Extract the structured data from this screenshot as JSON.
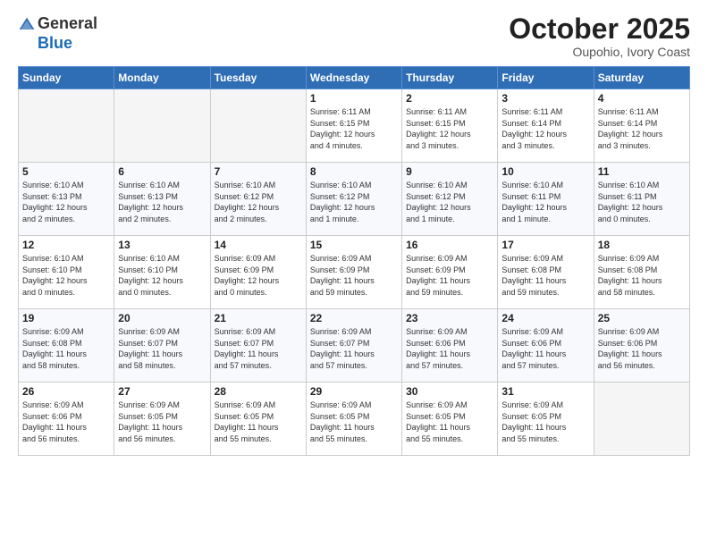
{
  "header": {
    "logo_general": "General",
    "logo_blue": "Blue",
    "month": "October 2025",
    "location": "Oupohio, Ivory Coast"
  },
  "days_of_week": [
    "Sunday",
    "Monday",
    "Tuesday",
    "Wednesday",
    "Thursday",
    "Friday",
    "Saturday"
  ],
  "weeks": [
    [
      {
        "day": "",
        "info": ""
      },
      {
        "day": "",
        "info": ""
      },
      {
        "day": "",
        "info": ""
      },
      {
        "day": "1",
        "info": "Sunrise: 6:11 AM\nSunset: 6:15 PM\nDaylight: 12 hours\nand 4 minutes."
      },
      {
        "day": "2",
        "info": "Sunrise: 6:11 AM\nSunset: 6:15 PM\nDaylight: 12 hours\nand 3 minutes."
      },
      {
        "day": "3",
        "info": "Sunrise: 6:11 AM\nSunset: 6:14 PM\nDaylight: 12 hours\nand 3 minutes."
      },
      {
        "day": "4",
        "info": "Sunrise: 6:11 AM\nSunset: 6:14 PM\nDaylight: 12 hours\nand 3 minutes."
      }
    ],
    [
      {
        "day": "5",
        "info": "Sunrise: 6:10 AM\nSunset: 6:13 PM\nDaylight: 12 hours\nand 2 minutes."
      },
      {
        "day": "6",
        "info": "Sunrise: 6:10 AM\nSunset: 6:13 PM\nDaylight: 12 hours\nand 2 minutes."
      },
      {
        "day": "7",
        "info": "Sunrise: 6:10 AM\nSunset: 6:12 PM\nDaylight: 12 hours\nand 2 minutes."
      },
      {
        "day": "8",
        "info": "Sunrise: 6:10 AM\nSunset: 6:12 PM\nDaylight: 12 hours\nand 1 minute."
      },
      {
        "day": "9",
        "info": "Sunrise: 6:10 AM\nSunset: 6:12 PM\nDaylight: 12 hours\nand 1 minute."
      },
      {
        "day": "10",
        "info": "Sunrise: 6:10 AM\nSunset: 6:11 PM\nDaylight: 12 hours\nand 1 minute."
      },
      {
        "day": "11",
        "info": "Sunrise: 6:10 AM\nSunset: 6:11 PM\nDaylight: 12 hours\nand 0 minutes."
      }
    ],
    [
      {
        "day": "12",
        "info": "Sunrise: 6:10 AM\nSunset: 6:10 PM\nDaylight: 12 hours\nand 0 minutes."
      },
      {
        "day": "13",
        "info": "Sunrise: 6:10 AM\nSunset: 6:10 PM\nDaylight: 12 hours\nand 0 minutes."
      },
      {
        "day": "14",
        "info": "Sunrise: 6:09 AM\nSunset: 6:09 PM\nDaylight: 12 hours\nand 0 minutes."
      },
      {
        "day": "15",
        "info": "Sunrise: 6:09 AM\nSunset: 6:09 PM\nDaylight: 11 hours\nand 59 minutes."
      },
      {
        "day": "16",
        "info": "Sunrise: 6:09 AM\nSunset: 6:09 PM\nDaylight: 11 hours\nand 59 minutes."
      },
      {
        "day": "17",
        "info": "Sunrise: 6:09 AM\nSunset: 6:08 PM\nDaylight: 11 hours\nand 59 minutes."
      },
      {
        "day": "18",
        "info": "Sunrise: 6:09 AM\nSunset: 6:08 PM\nDaylight: 11 hours\nand 58 minutes."
      }
    ],
    [
      {
        "day": "19",
        "info": "Sunrise: 6:09 AM\nSunset: 6:08 PM\nDaylight: 11 hours\nand 58 minutes."
      },
      {
        "day": "20",
        "info": "Sunrise: 6:09 AM\nSunset: 6:07 PM\nDaylight: 11 hours\nand 58 minutes."
      },
      {
        "day": "21",
        "info": "Sunrise: 6:09 AM\nSunset: 6:07 PM\nDaylight: 11 hours\nand 57 minutes."
      },
      {
        "day": "22",
        "info": "Sunrise: 6:09 AM\nSunset: 6:07 PM\nDaylight: 11 hours\nand 57 minutes."
      },
      {
        "day": "23",
        "info": "Sunrise: 6:09 AM\nSunset: 6:06 PM\nDaylight: 11 hours\nand 57 minutes."
      },
      {
        "day": "24",
        "info": "Sunrise: 6:09 AM\nSunset: 6:06 PM\nDaylight: 11 hours\nand 57 minutes."
      },
      {
        "day": "25",
        "info": "Sunrise: 6:09 AM\nSunset: 6:06 PM\nDaylight: 11 hours\nand 56 minutes."
      }
    ],
    [
      {
        "day": "26",
        "info": "Sunrise: 6:09 AM\nSunset: 6:06 PM\nDaylight: 11 hours\nand 56 minutes."
      },
      {
        "day": "27",
        "info": "Sunrise: 6:09 AM\nSunset: 6:05 PM\nDaylight: 11 hours\nand 56 minutes."
      },
      {
        "day": "28",
        "info": "Sunrise: 6:09 AM\nSunset: 6:05 PM\nDaylight: 11 hours\nand 55 minutes."
      },
      {
        "day": "29",
        "info": "Sunrise: 6:09 AM\nSunset: 6:05 PM\nDaylight: 11 hours\nand 55 minutes."
      },
      {
        "day": "30",
        "info": "Sunrise: 6:09 AM\nSunset: 6:05 PM\nDaylight: 11 hours\nand 55 minutes."
      },
      {
        "day": "31",
        "info": "Sunrise: 6:09 AM\nSunset: 6:05 PM\nDaylight: 11 hours\nand 55 minutes."
      },
      {
        "day": "",
        "info": ""
      }
    ]
  ]
}
